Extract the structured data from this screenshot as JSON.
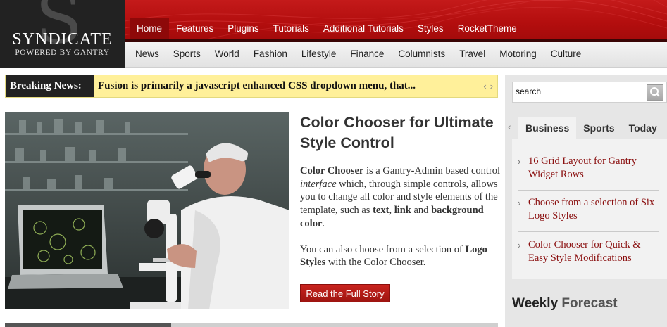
{
  "logo": {
    "letter": "S",
    "title": "SYNDICATE",
    "subtitle": "POWERED BY GANTRY"
  },
  "top_nav": [
    "Home",
    "Features",
    "Plugins",
    "Tutorials",
    "Additional Tutorials",
    "Styles",
    "RocketTheme"
  ],
  "sub_nav": [
    "News",
    "Sports",
    "World",
    "Fashion",
    "Lifestyle",
    "Finance",
    "Columnists",
    "Travel",
    "Motoring",
    "Culture"
  ],
  "breaking": {
    "label": "Breaking News:",
    "text": "Fusion is primarily a javascript enhanced CSS dropdown menu, that..."
  },
  "feature": {
    "title": "Color Chooser for Ultimate Style Control",
    "p1": {
      "b1": "Color Chooser",
      "t1": " is a Gantry-Admin based control ",
      "i1": "interface",
      "t2": " which, through simple controls, allows you to change all color and style elements of the template, such as ",
      "b2": "text",
      "t3": ", ",
      "b3": "link",
      "t4": " and ",
      "b4": "background color",
      "t5": "."
    },
    "p2": {
      "t1": "You can also choose from a selection of ",
      "b1": "Logo Styles",
      "t2": " with the Color Chooser."
    },
    "button": "Read the Full Story"
  },
  "sidebar": {
    "search_value": "search",
    "tabs": [
      "Business",
      "Sports",
      "Today"
    ],
    "items": [
      "16 Grid Layout for Gantry Widget Rows",
      "Choose from a selection of Six Logo Styles",
      "Color Chooser for Quick & Easy Style Modifications"
    ],
    "weekly_bold": "Weekly",
    "weekly_light": "Forecast"
  },
  "colors": {
    "brand_red": "#b30e0e",
    "ticker_yellow": "#fff09a",
    "link_red": "#8a0f0f"
  }
}
